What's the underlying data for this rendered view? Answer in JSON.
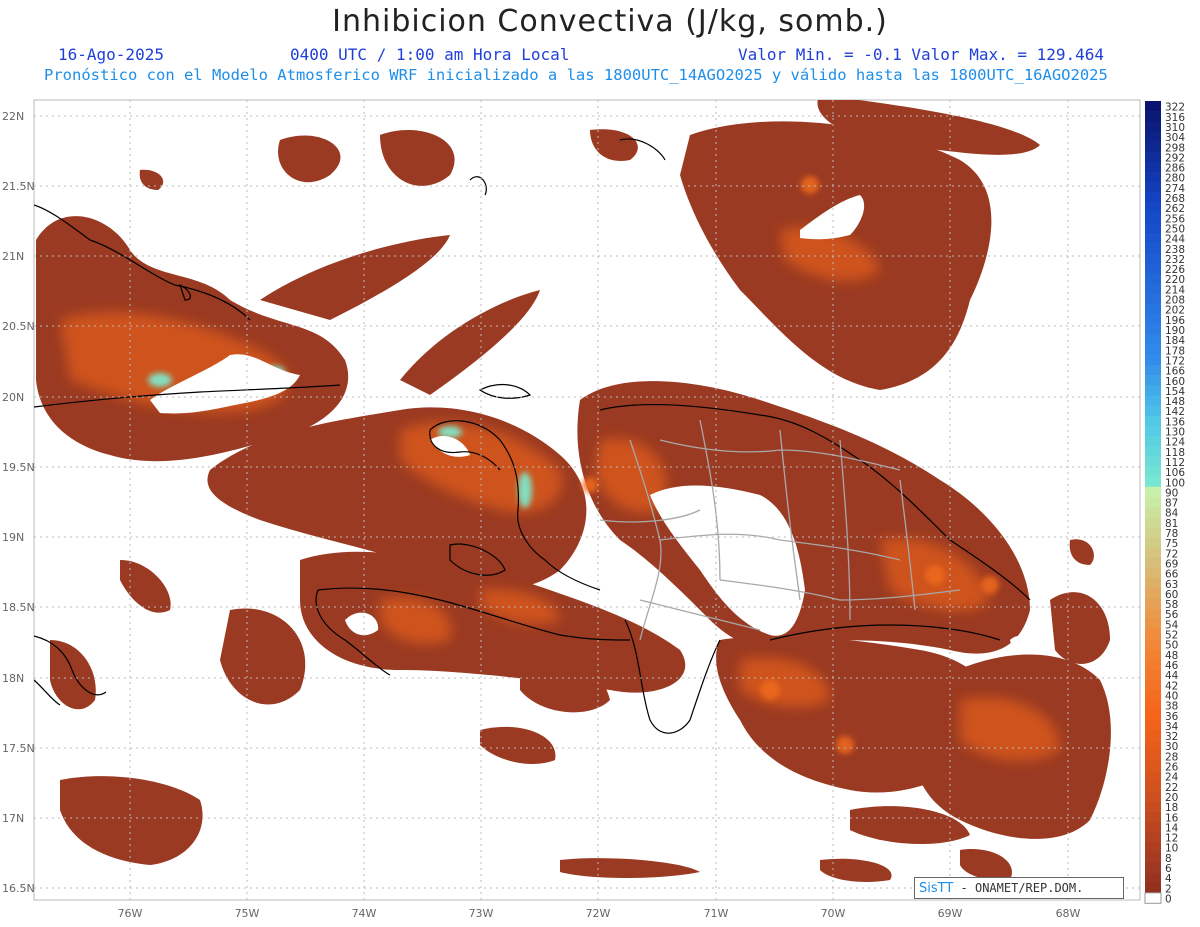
{
  "header": {
    "title": "Inhibicion Convectiva (J/kg, somb.)",
    "date": "16-Ago-2025",
    "time": "0400 UTC / 1:00 am Hora Local",
    "minmax": "Valor Min. = -0.1  Valor Max. = 129.464",
    "subtitle": "Pronóstico con el Modelo Atmosferico WRF inicializado a las 1800UTC_14AGO2025 y válido hasta las  1800UTC_16AGO2025"
  },
  "map": {
    "lat_labels": [
      "22N",
      "21.5N",
      "21N",
      "20.5N",
      "20N",
      "19.5N",
      "19N",
      "18.5N",
      "18N",
      "17.5N",
      "17N",
      "16.5N"
    ],
    "lon_labels": [
      "76W",
      "75W",
      "74W",
      "73W",
      "72W",
      "71W",
      "70W",
      "69W",
      "68W"
    ],
    "lat_range": [
      16.5,
      22
    ],
    "lon_range": [
      -76,
      -68
    ],
    "grid": "dotted"
  },
  "colorbar": {
    "labels": [
      "322",
      "316",
      "310",
      "304",
      "298",
      "292",
      "286",
      "280",
      "274",
      "268",
      "262",
      "256",
      "250",
      "244",
      "238",
      "232",
      "226",
      "220",
      "214",
      "208",
      "202",
      "196",
      "190",
      "184",
      "178",
      "172",
      "166",
      "160",
      "154",
      "148",
      "142",
      "136",
      "130",
      "124",
      "118",
      "112",
      "106",
      "100",
      "90",
      "87",
      "84",
      "81",
      "78",
      "75",
      "72",
      "69",
      "66",
      "63",
      "60",
      "58",
      "56",
      "54",
      "52",
      "50",
      "48",
      "46",
      "44",
      "42",
      "40",
      "38",
      "36",
      "34",
      "32",
      "30",
      "28",
      "26",
      "24",
      "22",
      "20",
      "18",
      "16",
      "14",
      "12",
      "10",
      "8",
      "6",
      "4",
      "2",
      "0"
    ]
  },
  "credit": {
    "sis": "SisTT",
    "text": "- ONAMET/REP.DOM."
  },
  "colors": {
    "fill_dark": "#9a3a22",
    "fill_orange": "#d4561f",
    "fill_bright": "#f06a1c",
    "fill_cyan": "#7fe6c8",
    "title_blue": "#1f3fd8",
    "subtitle_blue": "#1e8ee8"
  }
}
